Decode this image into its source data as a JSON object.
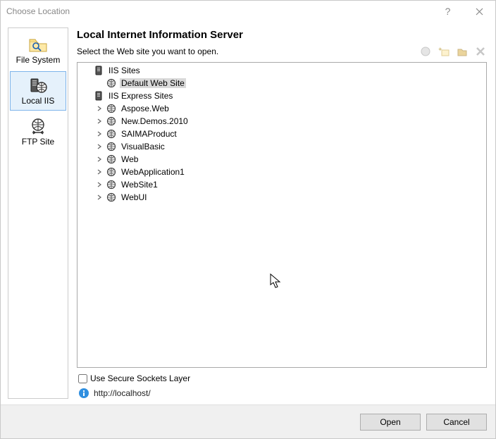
{
  "title": "Choose Location",
  "sidebar": {
    "items": [
      {
        "id": "file-system",
        "label": "File System",
        "selected": false
      },
      {
        "id": "local-iis",
        "label": "Local IIS",
        "selected": true
      },
      {
        "id": "ftp-site",
        "label": "FTP Site",
        "selected": false
      }
    ]
  },
  "content": {
    "heading": "Local Internet Information Server",
    "subtitle": "Select the Web site you want to open.",
    "toolbar": [
      {
        "id": "new-application",
        "name": "new-application-icon"
      },
      {
        "id": "new-virtual-dir",
        "name": "new-virtual-dir-icon"
      },
      {
        "id": "open-folder",
        "name": "open-folder-icon"
      },
      {
        "id": "delete",
        "name": "delete-icon"
      }
    ]
  },
  "tree": {
    "iis_sites_label": "IIS Sites",
    "iis_sites_children": [
      {
        "label": "Default Web Site",
        "selected": true
      }
    ],
    "iis_express_label": "IIS Express Sites",
    "iis_express_children": [
      {
        "label": "Aspose.Web"
      },
      {
        "label": "New.Demos.2010"
      },
      {
        "label": "SAIMAProduct"
      },
      {
        "label": "VisualBasic"
      },
      {
        "label": "Web"
      },
      {
        "label": "WebApplication1"
      },
      {
        "label": "WebSite1"
      },
      {
        "label": "WebUI"
      }
    ]
  },
  "ssl": {
    "label": "Use Secure Sockets Layer",
    "checked": false
  },
  "url": "http://localhost/",
  "buttons": {
    "open": "Open",
    "cancel": "Cancel"
  }
}
